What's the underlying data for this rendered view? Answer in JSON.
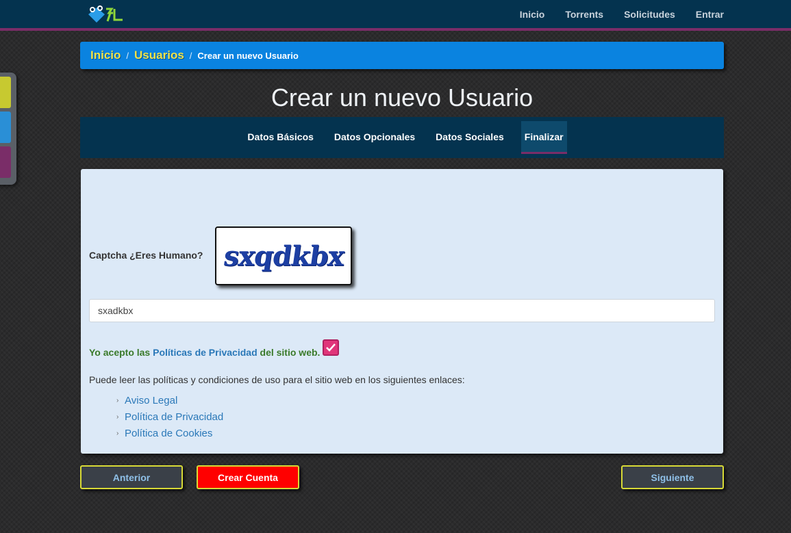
{
  "nav": {
    "links": [
      "Inicio",
      "Torrents",
      "Solicitudes",
      "Entrar"
    ]
  },
  "breadcrumb": {
    "home": "Inicio",
    "users": "Usuarios",
    "current": "Crear un nuevo Usuario"
  },
  "page": {
    "title": "Crear un nuevo Usuario"
  },
  "tabs": [
    {
      "label": "Datos Básicos",
      "active": false
    },
    {
      "label": "Datos Opcionales",
      "active": false
    },
    {
      "label": "Datos Sociales",
      "active": false
    },
    {
      "label": "Finalizar",
      "active": true
    }
  ],
  "form": {
    "captcha_label": "Captcha ¿Eres Humano?",
    "captcha_image_text": "sxqdkbx",
    "captcha_value": "sxadkbx",
    "accept_prefix": "Yo acepto las ",
    "accept_link": "Políticas de Privacidad",
    "accept_suffix": " del sitio web.",
    "accept_checked": true,
    "intro": "Puede leer las políticas y condiciones de uso para el sitio web en los siguientes enlaces:",
    "links": [
      "Aviso Legal",
      "Política de Privacidad",
      "Política de Cookies"
    ]
  },
  "buttons": {
    "prev": "Anterior",
    "create": "Crear Cuenta",
    "next": "Siguiente"
  },
  "colors": {
    "navbar": "#04334f",
    "accent_purple": "#7a2d68",
    "breadcrumb_blue": "#0a83e0",
    "breadcrumb_link": "#f0e34a",
    "panel": "#dce9f7",
    "create_button": "#ff0000"
  }
}
